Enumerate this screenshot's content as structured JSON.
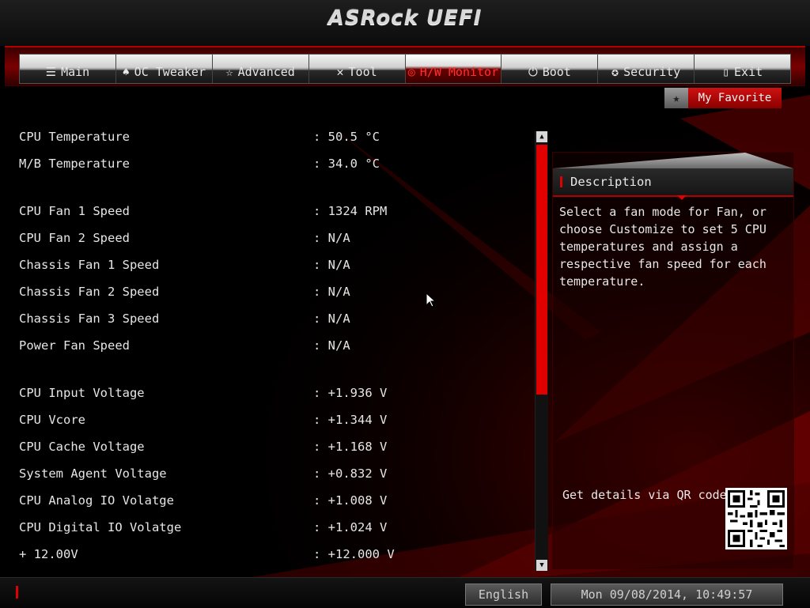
{
  "app": {
    "title": "ASRock UEFI"
  },
  "nav": {
    "tabs": [
      {
        "label": "Main",
        "icon": "list-icon"
      },
      {
        "label": "OC Tweaker",
        "icon": "rocket-icon"
      },
      {
        "label": "Advanced",
        "icon": "star-icon"
      },
      {
        "label": "Tool",
        "icon": "tools-icon"
      },
      {
        "label": "H/W Monitor",
        "icon": "monitor-icon",
        "active": true
      },
      {
        "label": "Boot",
        "icon": "power-icon"
      },
      {
        "label": "Security",
        "icon": "shield-icon"
      },
      {
        "label": "Exit",
        "icon": "exit-door-icon"
      }
    ]
  },
  "favorite": {
    "label": "My Favorite"
  },
  "monitor": {
    "items": [
      {
        "label": "CPU Temperature",
        "value": ": 50.5 °C"
      },
      {
        "label": "M/B Temperature",
        "value": ": 34.0 °C"
      },
      {
        "label": "CPU Fan 1 Speed",
        "value": ": 1324 RPM"
      },
      {
        "label": "CPU Fan 2 Speed",
        "value": ": N/A"
      },
      {
        "label": "Chassis Fan 1 Speed",
        "value": ": N/A"
      },
      {
        "label": "Chassis Fan 2 Speed",
        "value": ": N/A"
      },
      {
        "label": "Chassis Fan 3 Speed",
        "value": ": N/A"
      },
      {
        "label": "Power Fan Speed",
        "value": ": N/A"
      },
      {
        "label": "CPU Input Voltage",
        "value": ": +1.936 V"
      },
      {
        "label": "CPU Vcore",
        "value": ": +1.344 V"
      },
      {
        "label": "CPU Cache Voltage",
        "value": ": +1.168 V"
      },
      {
        "label": "System Agent Voltage",
        "value": ": +0.832 V"
      },
      {
        "label": "CPU Analog IO Volatge",
        "value": ": +1.008 V"
      },
      {
        "label": "CPU Digital IO Volatge",
        "value": ": +1.024 V"
      },
      {
        "label": "+ 12.00V",
        "value": ": +12.000 V"
      }
    ]
  },
  "description": {
    "title": "Description",
    "text": "Select a fan mode for Fan, or choose Customize to set 5 CPU temperatures and assign a respective fan speed for each temperature.",
    "qr_label": "Get details via QR code"
  },
  "footer": {
    "language": "English",
    "datetime": "Mon 09/08/2014, 10:49:57"
  },
  "colors": {
    "accent": "#e00000",
    "background": "#000000",
    "text": "#e6e6e6"
  }
}
